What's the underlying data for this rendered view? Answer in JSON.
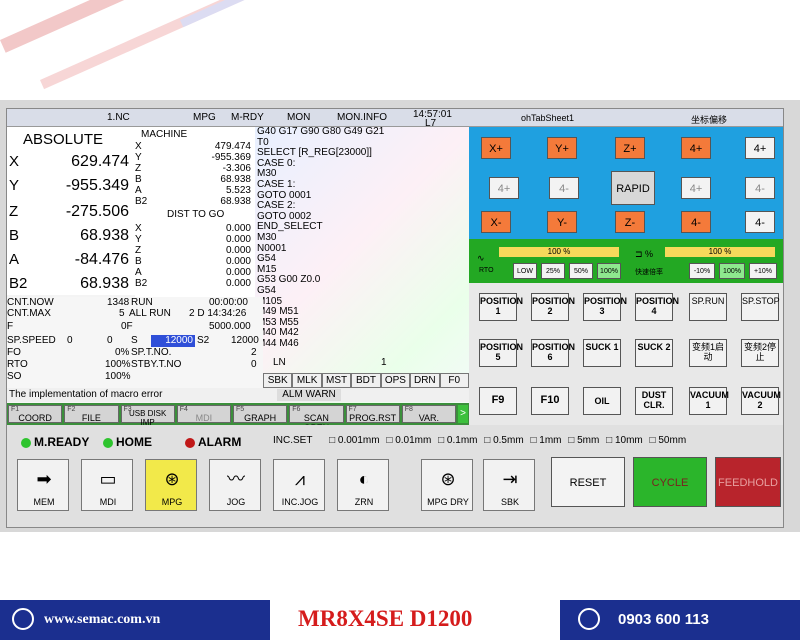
{
  "status": {
    "prog": "1.NC",
    "mode": "MPG",
    "state": "M-RDY",
    "mon": "MON",
    "moninfo": "MON.INFO",
    "time": "14:57:01",
    "tool": "L7",
    "tab": "ohTabSheet1",
    "coord": "坐标偏移"
  },
  "absolute": {
    "title": "ABSOLUTE",
    "axes": [
      {
        "name": "X",
        "value": "629.474"
      },
      {
        "name": "Y",
        "value": "-955.349"
      },
      {
        "name": "Z",
        "value": "-275.506"
      },
      {
        "name": "B",
        "value": "68.938"
      },
      {
        "name": "A",
        "value": "-84.476"
      },
      {
        "name": "B2",
        "value": "68.938"
      }
    ]
  },
  "machine": {
    "title": "MACHINE",
    "axes": [
      {
        "name": "X",
        "value": "479.474"
      },
      {
        "name": "Y",
        "value": "-955.369"
      },
      {
        "name": "Z",
        "value": "-3.306"
      },
      {
        "name": "B",
        "value": "68.938"
      },
      {
        "name": "A",
        "value": "5.523"
      },
      {
        "name": "B2",
        "value": "68.938"
      }
    ],
    "dist_title": "DIST TO GO",
    "dist": [
      {
        "name": "X",
        "value": "0.000"
      },
      {
        "name": "Y",
        "value": "0.000"
      },
      {
        "name": "Z",
        "value": "0.000"
      },
      {
        "name": "B",
        "value": "0.000"
      },
      {
        "name": "A",
        "value": "0.000"
      },
      {
        "name": "B2",
        "value": "0.000"
      }
    ]
  },
  "code": [
    "G40 G17 G90 G80 G49 G21",
    "T0",
    "SELECT [R_REG[23000]]",
    "CASE 0:",
    "M30",
    "CASE 1:",
    "GOTO 0001",
    "CASE 2:",
    "GOTO 0002",
    "END_SELECT",
    "M30",
    "N0001",
    "G54",
    "M15",
    "G53 G00 Z0.0",
    "G54",
    "M105",
    "M49 M51",
    "M53 M55",
    "M40 M42",
    "M44 M46"
  ],
  "info": {
    "cnt_now_l": "CNT.NOW",
    "cnt_now_v": "1348",
    "run_l": "RUN",
    "run_v": "00:00:00",
    "cnt_max_l": "CNT.MAX",
    "cnt_max_v": "5",
    "allrun_l": "ALL RUN",
    "allrun_v": "2 D 14:34:26",
    "f_l": "F",
    "f_v": "0F",
    "f_set": "5000.000",
    "spspeed_l": "SP.SPEED",
    "spspeed_a": "0",
    "spspeed_b": "0",
    "s_l": "S",
    "s_v": "12000",
    "s2_l": "S2",
    "s2_v": "12000",
    "fo_l": "FO",
    "fo_v": "0%",
    "sptno_l": "SP.T.NO.",
    "sptno_v": "2",
    "rto_l": "RTO",
    "rto_v": "100%",
    "stby_l": "STBY.T.NO",
    "stby_v": "0",
    "so_l": "SO",
    "so_v": "100%"
  },
  "ln": {
    "label": "LN",
    "value": "1"
  },
  "modes": [
    "SBK",
    "MLK",
    "MST",
    "BDT",
    "OPS",
    "DRN",
    "F0"
  ],
  "message": "The implementation of macro error",
  "alarm": {
    "alm": "ALM",
    "warn": "WARN"
  },
  "fkeys": [
    {
      "n": "F1",
      "label": "COORD"
    },
    {
      "n": "F2",
      "label": "FILE"
    },
    {
      "n": "F3",
      "label": "USB DISK IMP"
    },
    {
      "n": "F4",
      "label": "MDI"
    },
    {
      "n": "F5",
      "label": "GRAPH"
    },
    {
      "n": "F6",
      "label": "SCAN OPEN"
    },
    {
      "n": "F7",
      "label": "PROG.RST"
    },
    {
      "n": "F8",
      "label": "VAR."
    }
  ],
  "jog": {
    "xp": "X+",
    "yp": "Y+",
    "zp": "Z+",
    "ap": "4+",
    "bp": "4+",
    "cp": "4+",
    "dm": "4-",
    "ep": "4+",
    "fm": "4-",
    "rapid": "RAPID",
    "xm": "X-",
    "ym": "Y-",
    "zm": "Z-",
    "am": "4-",
    "bm": "4-"
  },
  "override": {
    "left_pct": "100 %",
    "right_pct": "100 %",
    "left_tag": "RTO",
    "right_tag": "快速倍率",
    "left_btns": [
      "LOW",
      "25%",
      "50%",
      "100%"
    ],
    "right_btns": [
      "-10%",
      "100%",
      "+10%"
    ]
  },
  "options": [
    "POSITION 1",
    "POSITION 2",
    "POSITION 3",
    "POSITION 4",
    "SP.RUN",
    "SP.STOP",
    "POSITION 5",
    "POSITION 6",
    "SUCK 1",
    "SUCK 2",
    "变频1启动",
    "变频2停止",
    "F9",
    "F10",
    "OIL",
    "DUST CLR.",
    "VACUUM 1",
    "VACUUM 2"
  ],
  "leds": {
    "ready": "M.READY",
    "home": "HOME",
    "alarm": "ALARM"
  },
  "inc": {
    "label": "INC.SET",
    "steps": [
      "0.001mm",
      "0.01mm",
      "0.1mm",
      "0.5mm",
      "1mm",
      "5mm",
      "10mm",
      "50mm"
    ]
  },
  "modebtns": [
    "MEM",
    "MDI",
    "MPG",
    "JOG",
    "INC.JOG",
    "ZRN",
    "MPG DRY",
    "SBK"
  ],
  "bigbtns": {
    "reset": "RESET",
    "start": "CYCLE START",
    "hold": "FEEDHOLD"
  },
  "colors": {
    "start": "#2bb52b",
    "hold": "#b8242c",
    "accent": "#1b2f8f",
    "orange": "#f47a3a"
  },
  "footer": {
    "site": "www.semac.com.vn",
    "title": "MR8X4SE D1200",
    "phone": "0903 600 113"
  }
}
